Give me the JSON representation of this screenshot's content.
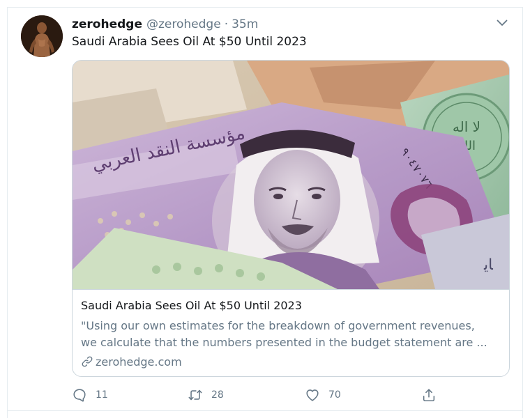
{
  "tweet": {
    "display_name": "zerohedge",
    "handle": "@zerohedge",
    "separator": "·",
    "time": "35m",
    "text": "Saudi Arabia Sees Oil At $50 Until 2023"
  },
  "card": {
    "title": "Saudi Arabia Sees Oil At $50 Until 2023",
    "description_line1": "\"Using our own estimates for the breakdown of government revenues,",
    "description_line2": "we calculate that the numbers presented in the budget statement are ...",
    "domain": "zerohedge.com"
  },
  "actions": {
    "reply_count": "11",
    "retweet_count": "28",
    "like_count": "70"
  },
  "icons": {
    "caret": "chevron-down-icon",
    "reply": "reply-icon",
    "retweet": "retweet-icon",
    "like": "heart-icon",
    "share": "share-icon",
    "link": "link-icon"
  },
  "colors": {
    "secondary_text": "#657786",
    "primary_text": "#14171a",
    "border": "#ccd6dd"
  }
}
